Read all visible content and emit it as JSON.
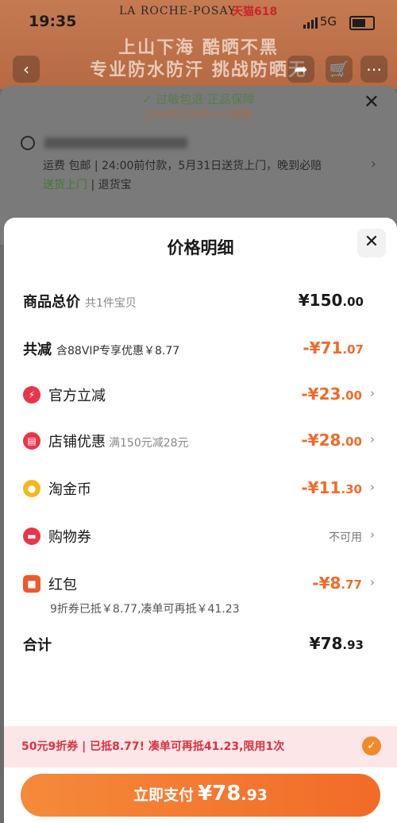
{
  "status_bar": {
    "time": "19:35",
    "network": "5G"
  },
  "background": {
    "brand": "LA ROCHE-POSAY",
    "brand_tag": "天猫618",
    "banner_line1": "上山下海 酷晒不黑",
    "banner_line2": "专业防水防汗 挑战防晒无",
    "guarantee": "过敏包退·正品保障",
    "promise": "24小时1000+人抢购",
    "shipping_line1": "运费 包邮 | 24:00前付款，5月31日送货上门，晚到必赔",
    "shipping_green": "送货上门",
    "shipping_rest": " | 退货宝"
  },
  "sheet": {
    "title": "价格明细",
    "rows": {
      "total": {
        "label": "商品总价",
        "sub": "共1件宝贝",
        "int": "¥150",
        "dec": ".00"
      },
      "discount": {
        "label": "共减",
        "sub": "含88VIP专享优惠￥8.77",
        "int": "-¥71",
        "dec": ".07"
      },
      "official": {
        "label": "官方立减",
        "int": "-¥23",
        "dec": ".00"
      },
      "store": {
        "label": "店铺优惠",
        "sub": "满150元减28元",
        "int": "-¥28",
        "dec": ".00"
      },
      "coins": {
        "label": "淘金币",
        "int": "-¥11",
        "dec": ".30"
      },
      "voucher": {
        "label": "购物券",
        "value": "不可用"
      },
      "redpacket": {
        "label": "红包",
        "int": "-¥8",
        "dec": ".77",
        "note": "9折券已抵￥8.77,凑单可再抵￥41.23"
      },
      "sum": {
        "label": "合计",
        "int": "¥78",
        "dec": ".93"
      }
    },
    "coupon_bar": "50元9折券 | 已抵8.77! 凑单可再抵41.23,限用1次",
    "pay_button": {
      "label": "立即支付",
      "int": "¥78",
      "dec": ".93"
    }
  },
  "colors": {
    "accent": "#f26a28",
    "coupon_text": "#d8333f",
    "coupon_bg": "#fde6e8"
  },
  "icons": {
    "official": "lightning-icon",
    "store": "shop-icon",
    "coins": "coin-icon",
    "voucher": "ticket-icon",
    "redpacket": "red-packet-icon"
  }
}
